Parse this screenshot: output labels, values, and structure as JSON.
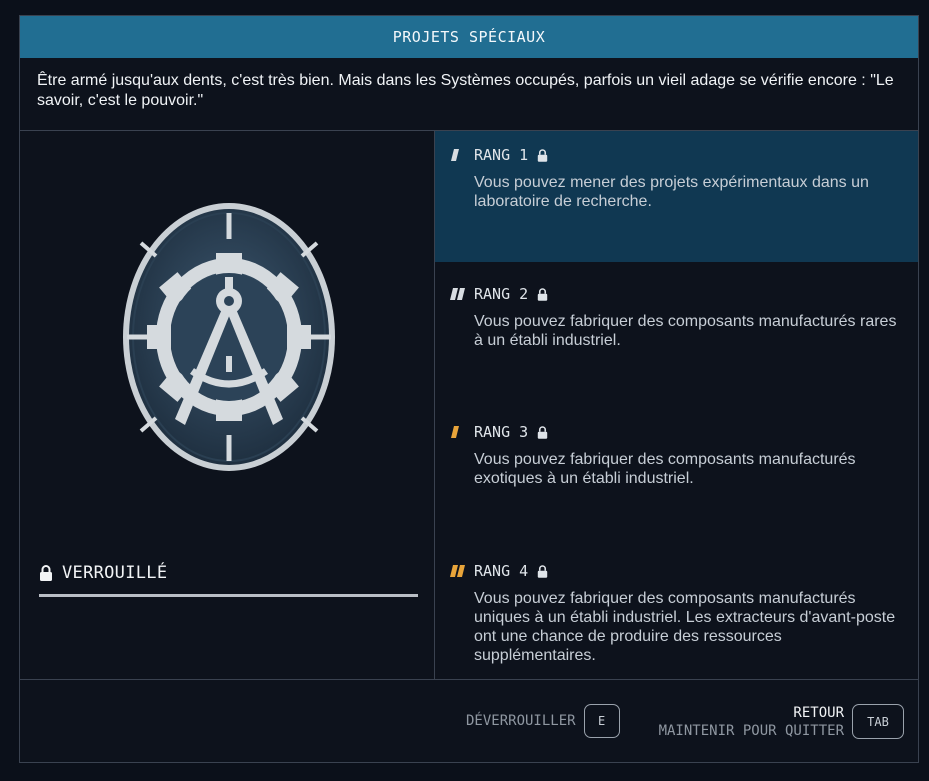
{
  "header": {
    "title": "PROJETS SPÉCIAUX"
  },
  "description": "Être armé jusqu'aux dents, c'est très bien. Mais dans les Systèmes occupés, parfois un vieil adage se vérifie encore : \"Le savoir, c'est le pouvoir.\"",
  "emblem": {
    "icon": "gear-compass-emblem-icon"
  },
  "status": {
    "label": "VERROUILLÉ",
    "icon": "lock-icon"
  },
  "ranks": [
    {
      "title": "RANG 1",
      "description": "Vous pouvez mener des projets expérimentaux dans un laboratoire de recherche.",
      "active": true,
      "indicator_color": "#d8dde2"
    },
    {
      "title": "RANG 2",
      "description": "Vous pouvez fabriquer des composants manufacturés rares à un établi industriel.",
      "active": false,
      "indicator_color": "#d8dde2"
    },
    {
      "title": "RANG 3",
      "description": "Vous pouvez fabriquer des composants manufacturés exotiques à un établi industriel.",
      "active": false,
      "indicator_color": "#e8a43a"
    },
    {
      "title": "RANG 4",
      "description": "Vous pouvez fabriquer des composants manufacturés uniques à un établi industriel. Les extracteurs d'avant-poste ont une chance de produire des ressources supplémentaires.",
      "active": false,
      "indicator_color": "#e8a43a"
    }
  ],
  "footer": {
    "unlock_label": "DÉVERROUILLER",
    "unlock_key": "E",
    "back_label": "RETOUR",
    "back_sub": "MAINTENIR POUR QUITTER",
    "back_key": "TAB"
  },
  "colors": {
    "header_bg": "#216e92",
    "active_rank_bg": "#103852",
    "accent_orange": "#e8a43a"
  }
}
